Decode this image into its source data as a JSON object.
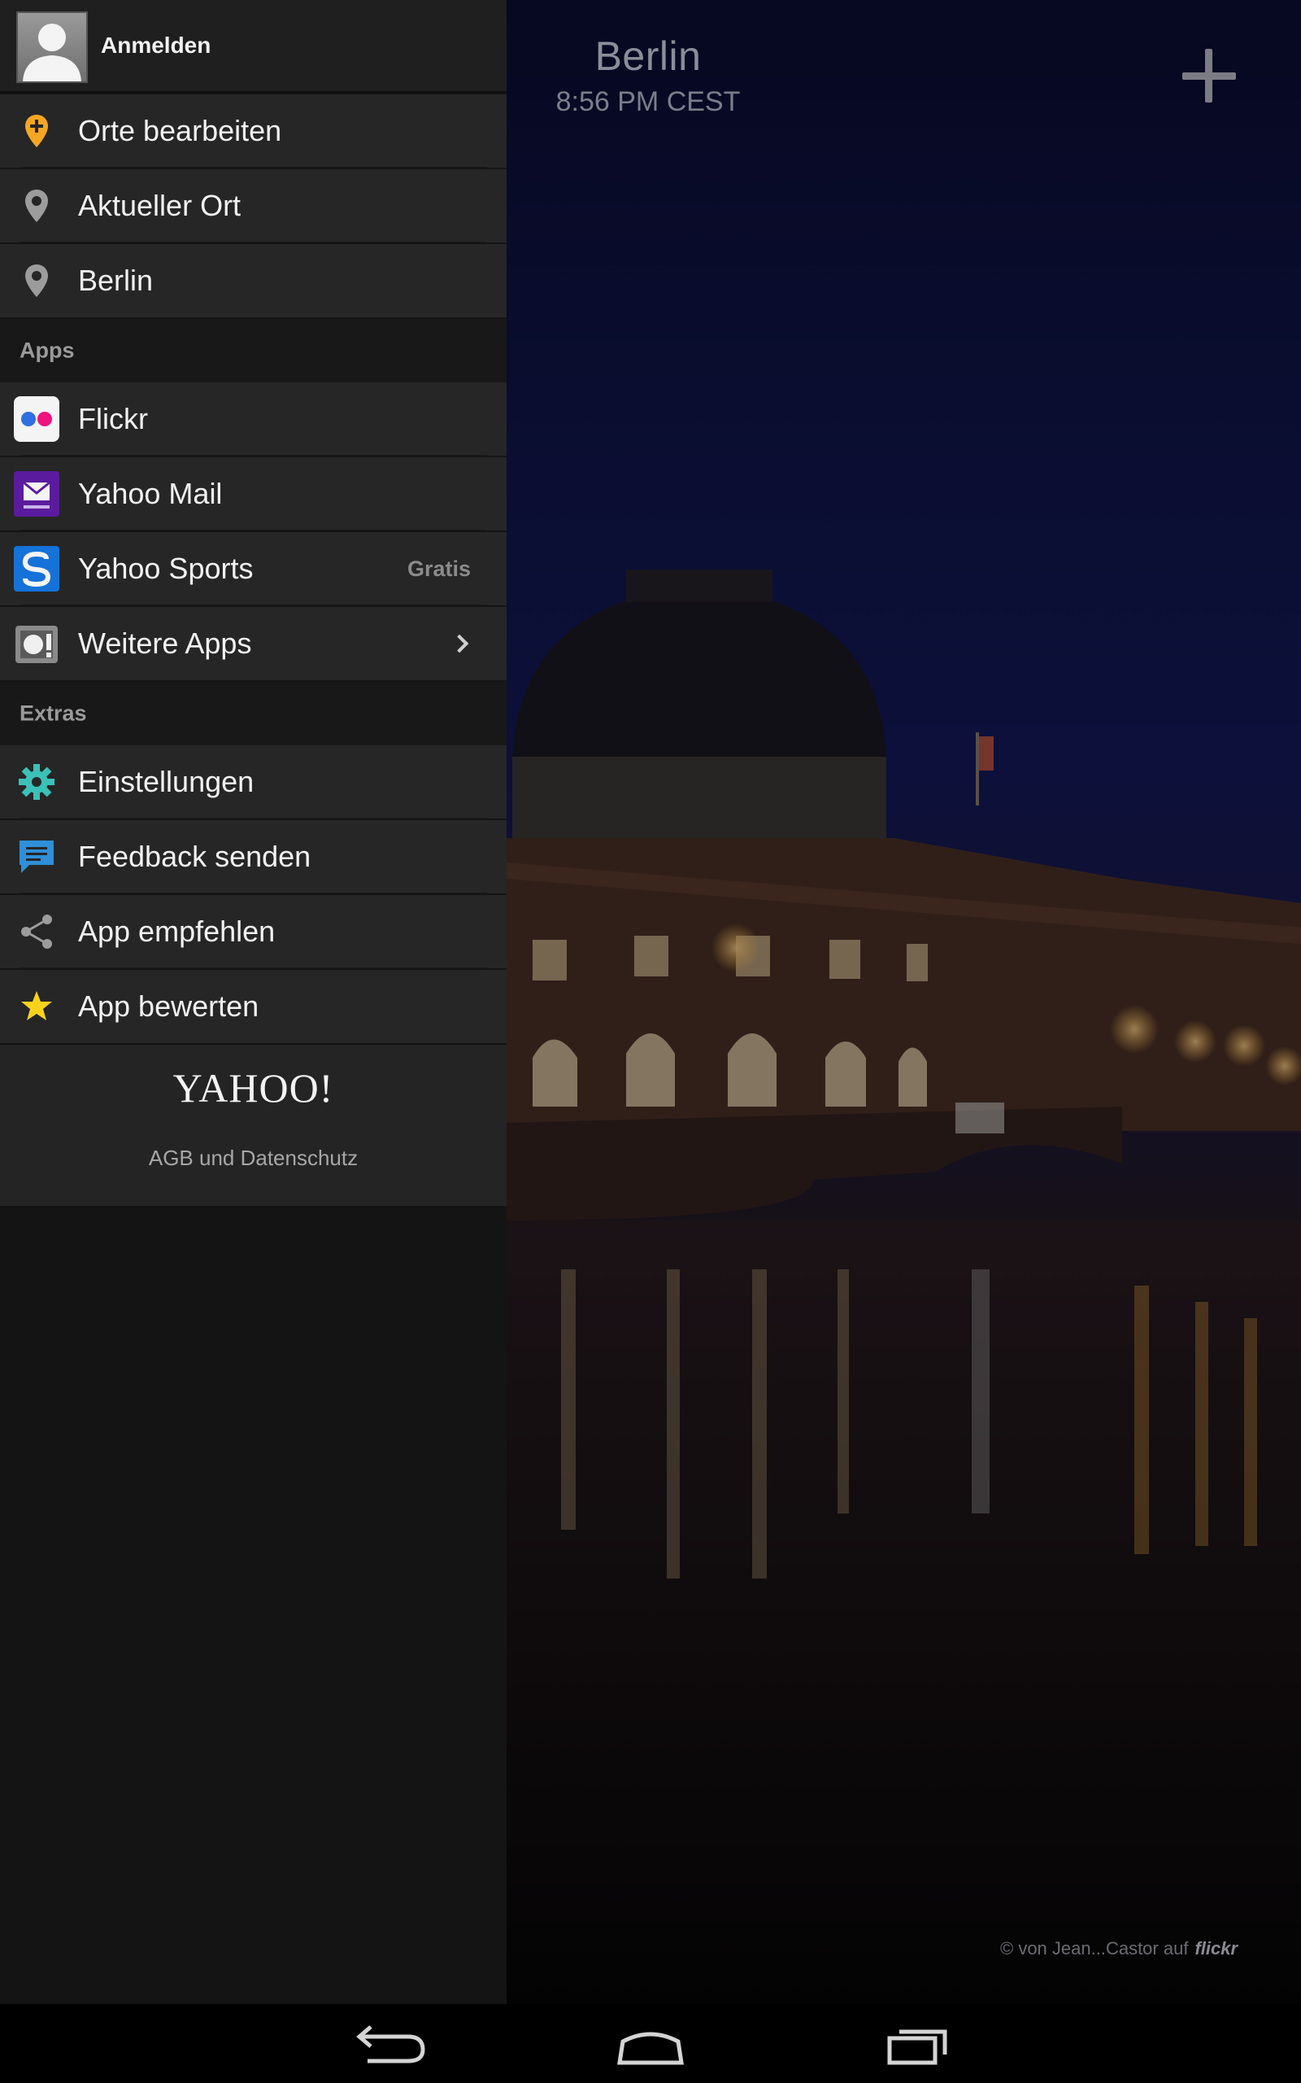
{
  "weather": {
    "city": "Berlin",
    "time": "8:56 PM CEST",
    "photo_credit": "© von Jean...Castor auf",
    "photo_credit_brand": "flickr"
  },
  "drawer": {
    "account": {
      "label": "Anmelden",
      "icon": "avatar-icon"
    },
    "locations": [
      {
        "label": "Orte bearbeiten",
        "icon": "edit-location-icon"
      },
      {
        "label": "Aktueller Ort",
        "icon": "location-pin-icon"
      },
      {
        "label": "Berlin",
        "icon": "location-pin-icon"
      }
    ],
    "apps_header": "Apps",
    "apps": [
      {
        "label": "Flickr",
        "icon": "flickr-icon"
      },
      {
        "label": "Yahoo Mail",
        "icon": "yahoo-mail-icon"
      },
      {
        "label": "Yahoo Sports",
        "icon": "yahoo-sports-icon",
        "badge": "Gratis"
      },
      {
        "label": "Weitere Apps",
        "icon": "more-apps-icon"
      }
    ],
    "extras_header": "Extras",
    "extras": [
      {
        "label": "Einstellungen",
        "icon": "gear-icon"
      },
      {
        "label": "Feedback senden",
        "icon": "feedback-icon"
      },
      {
        "label": "App empfehlen",
        "icon": "share-icon"
      },
      {
        "label": "App bewerten",
        "icon": "star-icon"
      }
    ],
    "footer": {
      "logo": "YAHOO!",
      "link": "AGB und Datenschutz"
    }
  },
  "colors": {
    "accent_orange": "#f5a623",
    "settings_teal": "#3bc1b6",
    "feedback_blue": "#2f8fd8",
    "star_yellow": "#f7d21c",
    "drawer_row": "#262626",
    "drawer_bg": "#141414"
  }
}
